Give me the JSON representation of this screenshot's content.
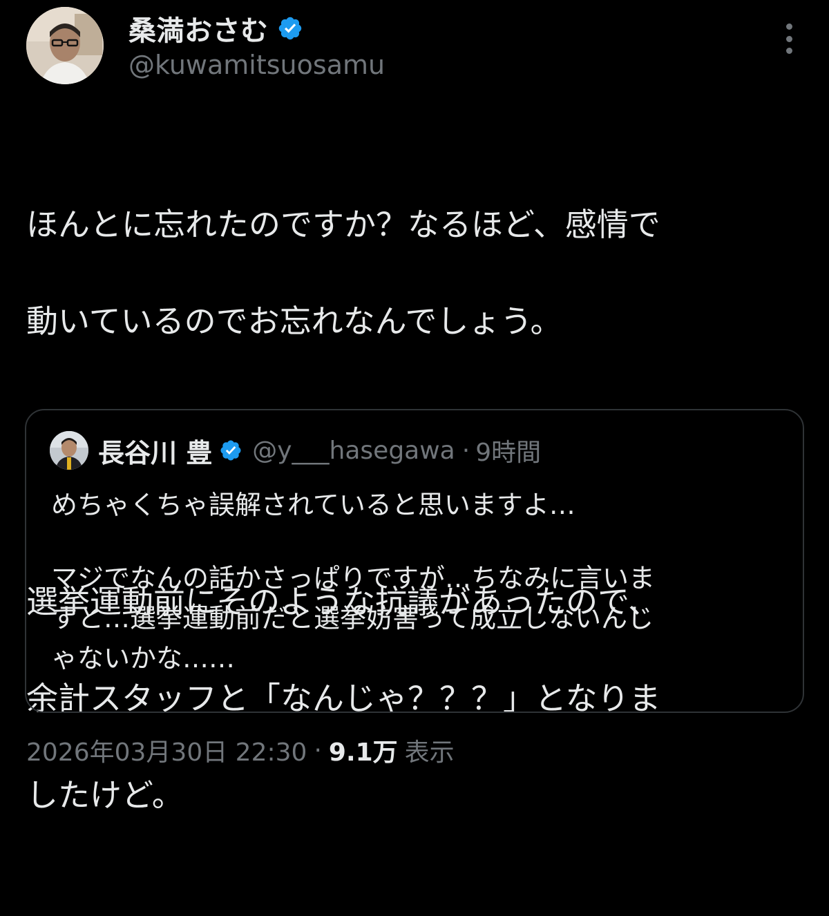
{
  "author": {
    "display_name": "桑満おさむ",
    "handle": "@kuwamitsuosamu",
    "verified": true
  },
  "tweet": {
    "paragraphs": [
      {
        "lines": [
          "ほんとに忘れたのですか？なるほど、感情で",
          "動いているのでお忘れなんでしょう。"
        ]
      },
      {
        "lines": [
          "選挙運動前にそのような抗議があったので、",
          "余計スタッフと「なんじゃ？？？」となりま",
          "したけど。"
        ]
      }
    ]
  },
  "quote": {
    "display_name": "長谷川 豊",
    "handle": "@y___hasegawa",
    "separator": "·",
    "time_ago": "9時間",
    "verified": true,
    "paragraphs": [
      {
        "lines": [
          "めちゃくちゃ誤解されていると思いますよ…"
        ]
      },
      {
        "lines": [
          "マジでなんの話かさっぱりですが…ちなみに言いま",
          "すと…選挙運動前だと選挙妨害って成立しないんじ",
          "ゃないかな……"
        ]
      }
    ]
  },
  "meta": {
    "timestamp": "2026年03月30日 22:30",
    "separator": "·",
    "views_count": "9.1万",
    "views_label": "表示"
  },
  "colors": {
    "background": "#000000",
    "text_primary": "#e7e9ea",
    "text_secondary": "#71767b",
    "border": "#2f3336",
    "verified_blue": "#1d9bf0"
  },
  "icons": {
    "verified": "verified-badge-icon",
    "more": "more-dots-icon"
  }
}
